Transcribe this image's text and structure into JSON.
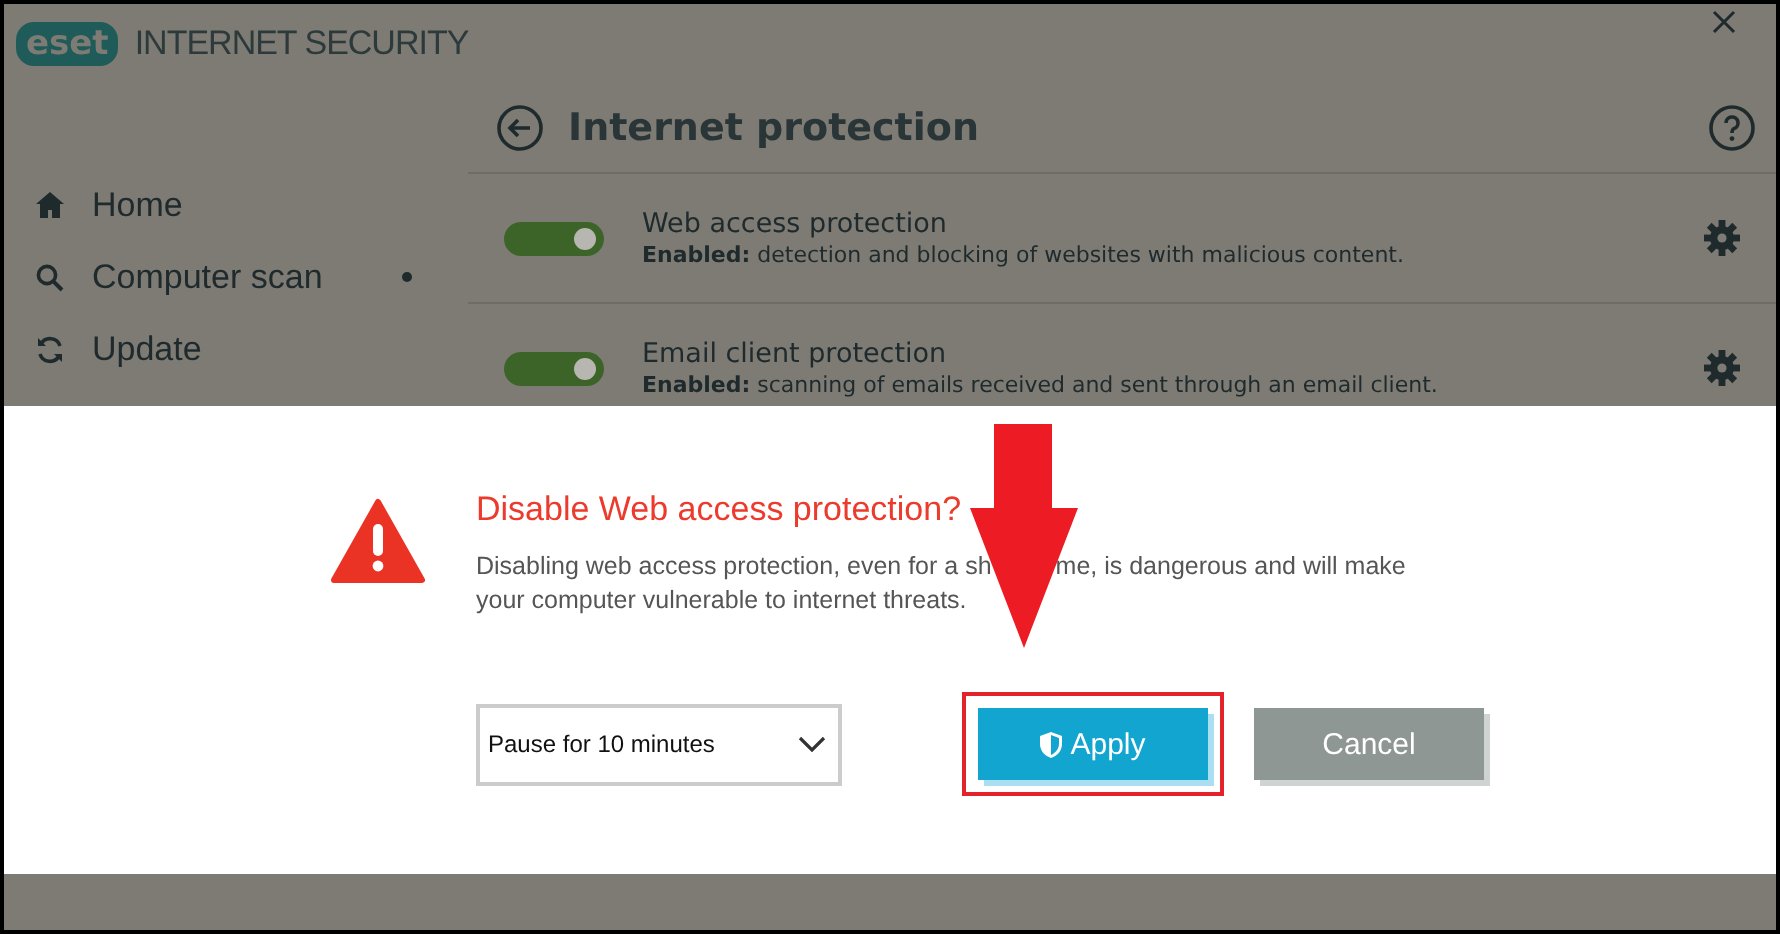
{
  "app": {
    "logo": "eset",
    "title": "INTERNET SECURITY"
  },
  "sidebar": {
    "items": [
      {
        "label": "Home",
        "notification": false
      },
      {
        "label": "Computer scan",
        "notification": true
      },
      {
        "label": "Update",
        "notification": false
      }
    ]
  },
  "page": {
    "title": "Internet protection"
  },
  "features": [
    {
      "name": "Web access protection",
      "status": "Enabled:",
      "description": "detection and blocking of websites with malicious content.",
      "on": true
    },
    {
      "name": "Email client protection",
      "status": "Enabled:",
      "description": "scanning of emails received and sent through an email client.",
      "on": true
    }
  ],
  "dialog": {
    "title": "Disable Web access protection?",
    "message_parts": [
      "Disabling web access protection, even for a sh",
      "me, is dangerous and will make",
      "your computer vulnerable to internet threats."
    ],
    "duration": {
      "value": "Pause for 10 minutes"
    },
    "buttons": [
      {
        "label": "Apply",
        "kind": "primary",
        "highlighted": true
      },
      {
        "label": "Cancel",
        "kind": "secondary",
        "highlighted": false
      }
    ]
  }
}
